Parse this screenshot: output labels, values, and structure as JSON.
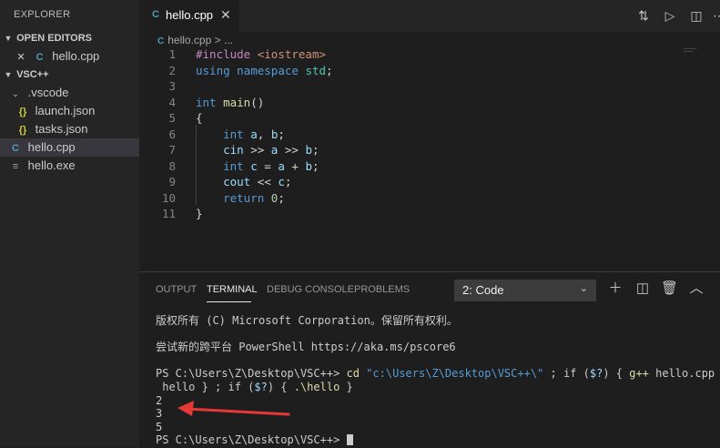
{
  "sidebar": {
    "title": "EXPLORER",
    "open_editors": {
      "label": "OPEN EDITORS",
      "items": [
        {
          "close": "✕",
          "name": "hello.cpp"
        }
      ]
    },
    "workspace": {
      "label": "VSC++"
    },
    "tree": [
      {
        "name": ".vscode"
      },
      {
        "name": "launch.json"
      },
      {
        "name": "tasks.json"
      },
      {
        "name": "hello.cpp"
      },
      {
        "name": "hello.exe"
      }
    ]
  },
  "editor": {
    "tab": {
      "label": "hello.cpp",
      "close": "✕"
    },
    "breadcrumb": {
      "file": "hello.cpp",
      "sep": ">",
      "more": "..."
    },
    "code": [
      {
        "n": "1",
        "t": "#include <iostream>"
      },
      {
        "n": "2",
        "t": "using namespace std;"
      },
      {
        "n": "3",
        "t": ""
      },
      {
        "n": "4",
        "t": "int main()"
      },
      {
        "n": "5",
        "t": "{"
      },
      {
        "n": "6",
        "t": "    int a, b;"
      },
      {
        "n": "7",
        "t": "    cin >> a >> b;"
      },
      {
        "n": "8",
        "t": "    int c = a + b;"
      },
      {
        "n": "9",
        "t": "    cout << c;"
      },
      {
        "n": "10",
        "t": "    return 0;"
      },
      {
        "n": "11",
        "t": "}"
      }
    ]
  },
  "panel": {
    "tabs": [
      "OUTPUT",
      "TERMINAL",
      "DEBUG CONSOLE",
      "PROBLEMS"
    ],
    "active_tab": "TERMINAL",
    "terminal_select": "2: Code",
    "terminal": [
      "版权所有 (C) Microsoft Corporation。保留所有权利。",
      "",
      "尝试新的跨平台 PowerShell https://aka.ms/pscore6",
      "",
      "PS C:\\Users\\Z\\Desktop\\VSC++> cd \"c:\\Users\\Z\\Desktop\\VSC++\\\" ; if ($?) { g++ hello.cpp -o",
      " hello } ; if ($?) { .\\hello }",
      "2",
      "3",
      "5",
      "PS C:\\Users\\Z\\Desktop\\VSC++> "
    ]
  },
  "colors": {
    "annotation_arrow": "#e53935",
    "keyword": "#569cd6",
    "string": "#ce9178"
  }
}
